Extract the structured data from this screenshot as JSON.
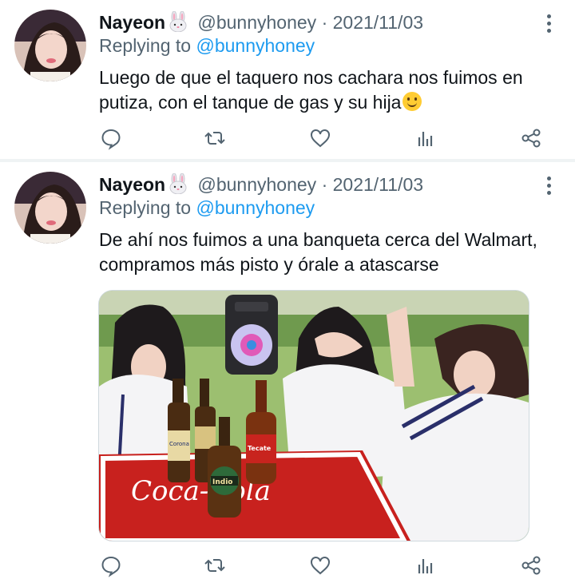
{
  "tweets": [
    {
      "name": "Nayeon",
      "handle": "@bunnyhoney",
      "separator": "·",
      "date": "2021/11/03",
      "replying_prefix": "Replying to",
      "replying_to": "@bunnyhoney",
      "text": "Luego de que el taquero nos cachara nos fuimos en putiza, con el tanque de gas y su hija",
      "emoji": "smiling-face-icon"
    },
    {
      "name": "Nayeon",
      "handle": "@bunnyhoney",
      "separator": "·",
      "date": "2021/11/03",
      "replying_prefix": "Replying to",
      "replying_to": "@bunnyhoney",
      "text": "De ahí nos fuimos a una banqueta cerca del Walmart, compramos más pisto y órale a atascarse",
      "media": {
        "table_brand": "Coca-Cola",
        "bottle_labels": [
          "Corona",
          "Indio",
          "Tecate"
        ]
      }
    }
  ],
  "action_icons": [
    "reply-icon",
    "retweet-icon",
    "like-icon",
    "views-icon",
    "share-icon"
  ],
  "colors": {
    "link": "#1d9bf0",
    "secondary": "#536471",
    "text": "#0f1419",
    "divider": "#eff3f4"
  }
}
